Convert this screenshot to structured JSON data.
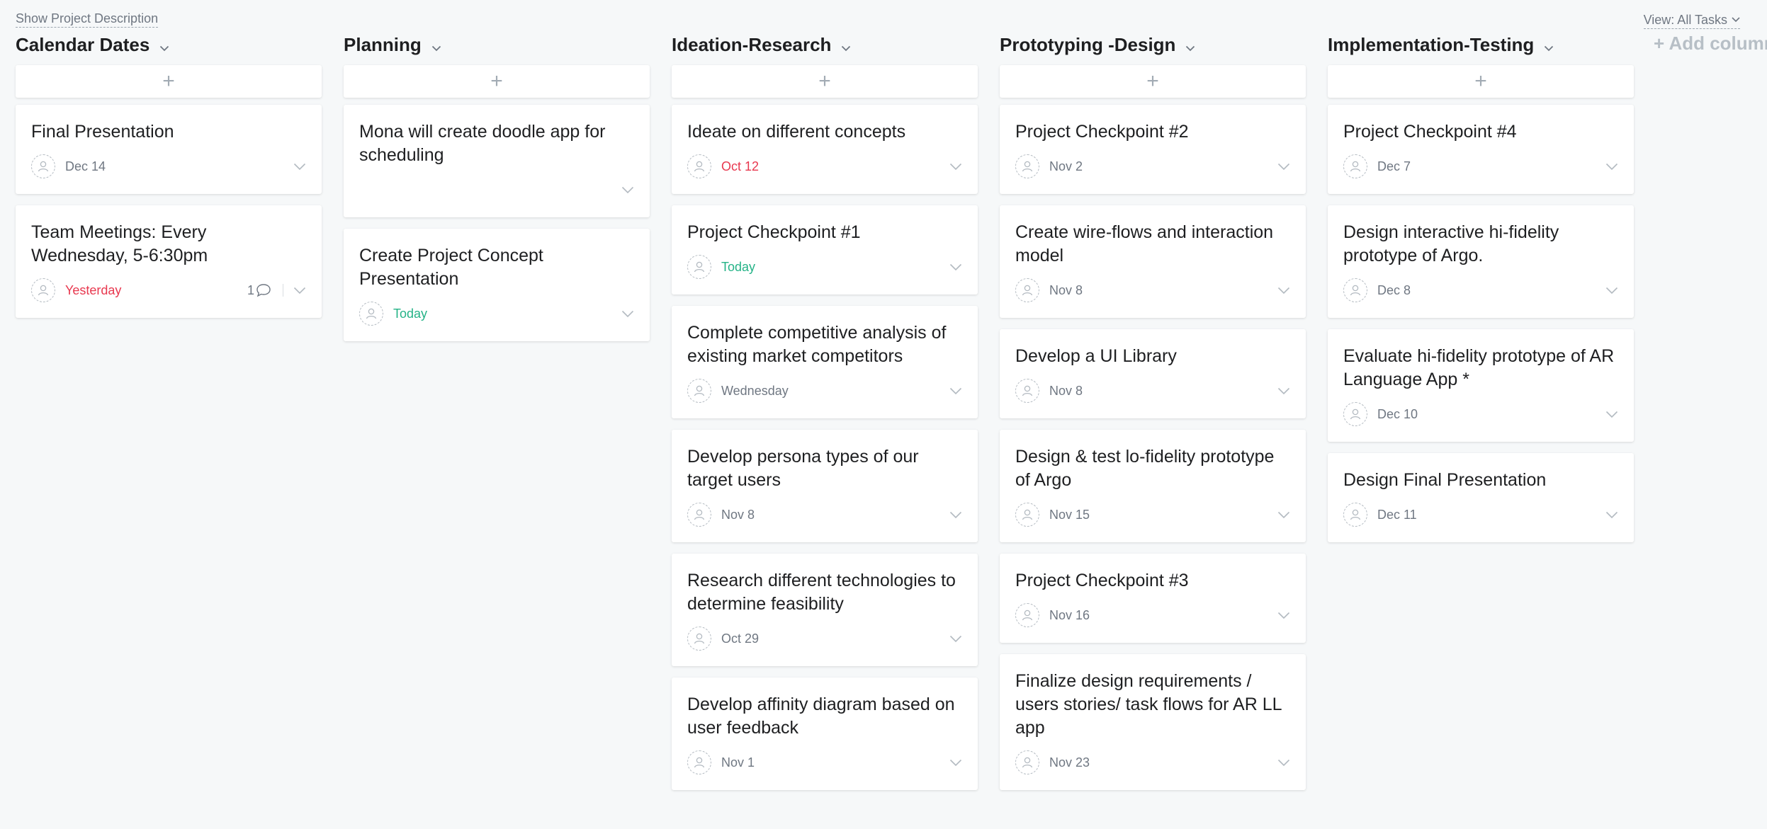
{
  "top": {
    "show_description": "Show Project Description",
    "view_filter": "View: All Tasks"
  },
  "columns": [
    {
      "name": "Calendar Dates",
      "add_symbol": "+",
      "cards": [
        {
          "title": "Final Presentation",
          "due": "Dec 14",
          "due_status": "normal"
        },
        {
          "title": "Team Meetings: Every Wednesday, 5-6:30pm",
          "due": "Yesterday",
          "due_status": "overdue",
          "comments": "1"
        }
      ]
    },
    {
      "name": "Planning",
      "add_symbol": "+",
      "cards": [
        {
          "title": "Mona will create doodle app for scheduling",
          "due": "",
          "due_status": "none"
        },
        {
          "title": "Create Project Concept Presentation",
          "due": "Today",
          "due_status": "today"
        }
      ]
    },
    {
      "name": "Ideation-Research",
      "add_symbol": "+",
      "cards": [
        {
          "title": "Ideate on different concepts",
          "due": "Oct 12",
          "due_status": "overdue"
        },
        {
          "title": "Project Checkpoint #1",
          "due": "Today",
          "due_status": "today"
        },
        {
          "title": "Complete competitive analysis of existing market competitors",
          "due": "Wednesday",
          "due_status": "normal"
        },
        {
          "title": "Develop persona types of our target users",
          "due": "Nov 8",
          "due_status": "normal"
        },
        {
          "title": "Research different technologies to determine feasibility",
          "due": "Oct 29",
          "due_status": "normal"
        },
        {
          "title": "Develop affinity diagram based on user feedback",
          "due": "Nov 1",
          "due_status": "normal"
        }
      ]
    },
    {
      "name": "Prototyping -Design",
      "add_symbol": "+",
      "cards": [
        {
          "title": "Project Checkpoint #2",
          "due": "Nov 2",
          "due_status": "normal"
        },
        {
          "title": "Create wire-flows and interaction model",
          "due": "Nov 8",
          "due_status": "normal"
        },
        {
          "title": "Develop a UI Library",
          "due": "Nov 8",
          "due_status": "normal"
        },
        {
          "title": "Design & test lo-fidelity prototype of Argo",
          "due": "Nov 15",
          "due_status": "normal"
        },
        {
          "title": "Project Checkpoint #3",
          "due": "Nov 16",
          "due_status": "normal"
        },
        {
          "title": "Finalize design requirements / users stories/ task flows for AR LL app",
          "due": "Nov 23",
          "due_status": "normal"
        }
      ]
    },
    {
      "name": "Implementation-Testing",
      "add_symbol": "+",
      "cards": [
        {
          "title": "Project Checkpoint #4",
          "due": "Dec 7",
          "due_status": "normal"
        },
        {
          "title": "Design interactive hi-fidelity prototype of Argo.",
          "due": "Dec 8",
          "due_status": "normal"
        },
        {
          "title": "Evaluate hi-fidelity prototype of AR Language App *",
          "due": "Dec 10",
          "due_status": "normal"
        },
        {
          "title": "Design Final Presentation",
          "due": "Dec 11",
          "due_status": "normal"
        }
      ]
    }
  ],
  "add_column_label": "+ Add column",
  "icons": {
    "column_menu": "chevron-down-icon",
    "avatar": "user-placeholder-icon",
    "comment": "comment-bubble-icon",
    "card_expand": "chevron-down-icon"
  },
  "colors": {
    "background": "#f6f8f9",
    "overdue": "#e8384f",
    "today": "#25b387",
    "muted": "#6f7782"
  }
}
